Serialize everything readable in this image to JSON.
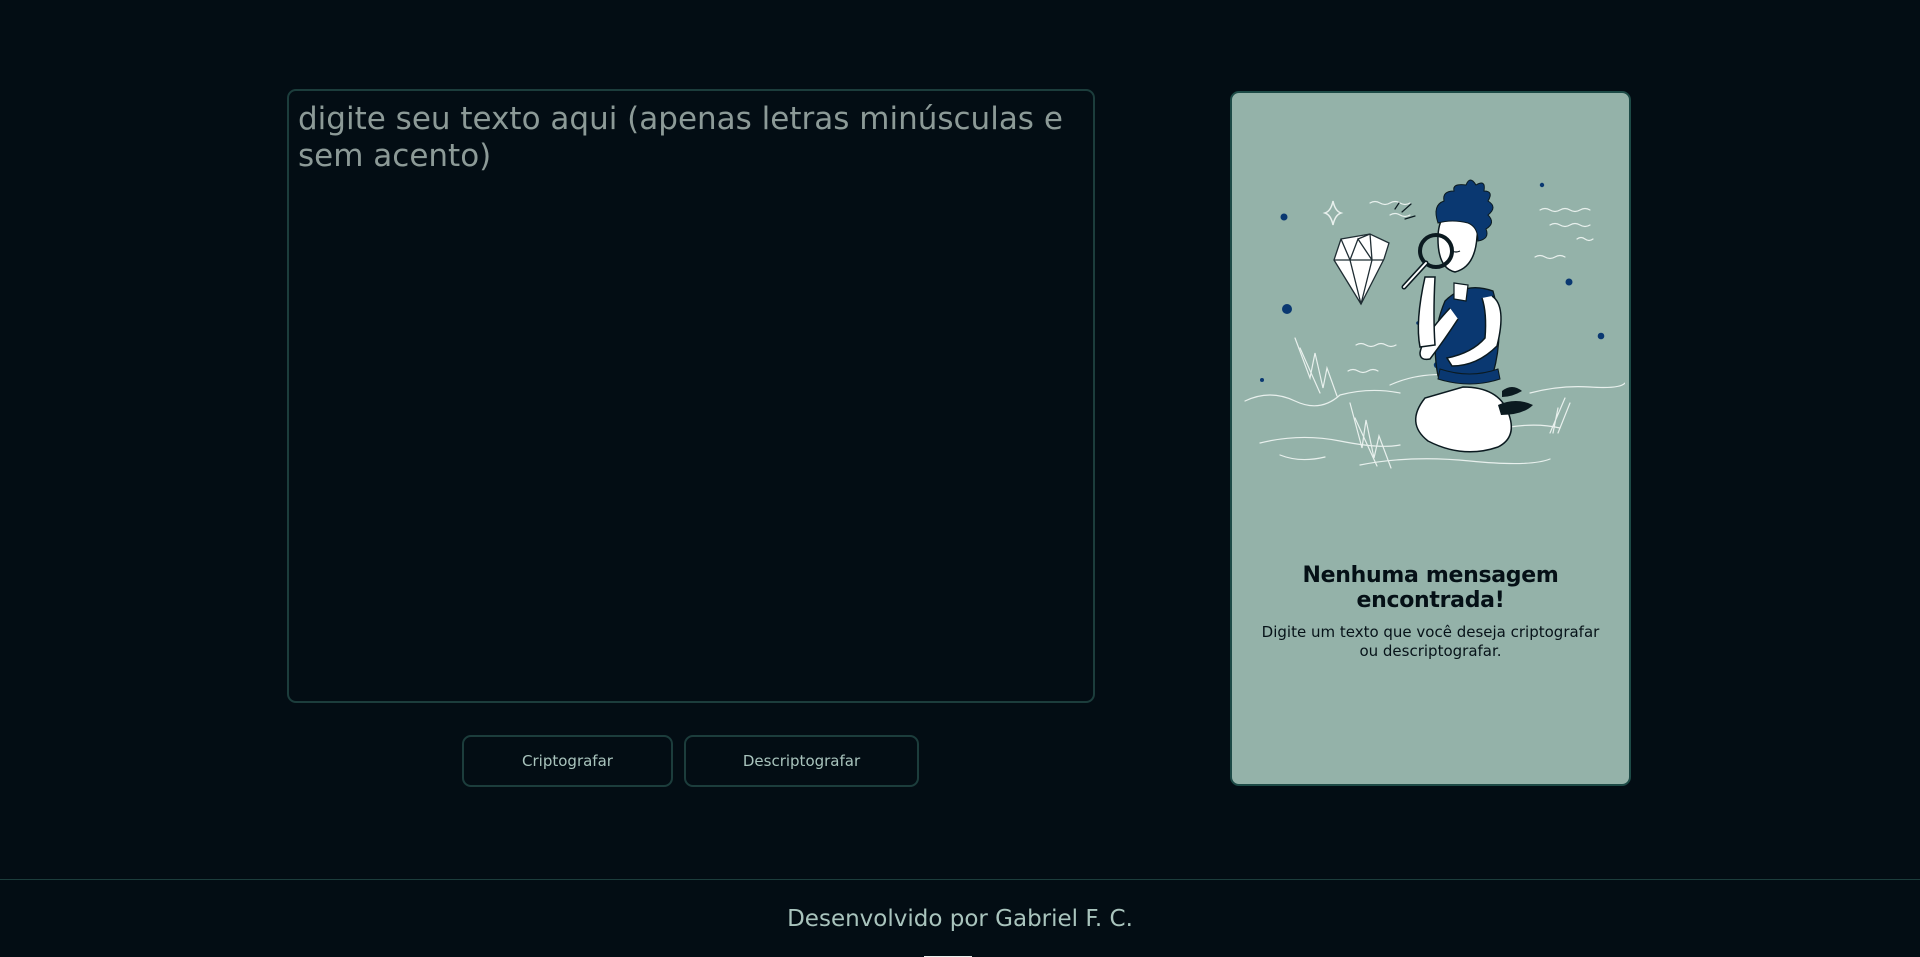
{
  "input": {
    "placeholder": "digite seu texto aqui (apenas letras minúsculas e sem acento)",
    "value": ""
  },
  "buttons": {
    "encrypt_label": "Criptografar",
    "decrypt_label": "Descriptografar"
  },
  "result": {
    "title": "Nenhuma mensagem encontrada!",
    "description": "Digite um texto que você deseja criptografar ou descriptografar.",
    "illustration": "person-with-magnifying-glass-diamond-illustration"
  },
  "footer": {
    "text": "Desenvolvido por Gabriel F. C."
  },
  "colors": {
    "background": "#030d14",
    "border": "#1c3d3c",
    "card_background": "#94b2a9",
    "accent_blue": "#0a3871",
    "button_text": "#a9c4bd"
  }
}
